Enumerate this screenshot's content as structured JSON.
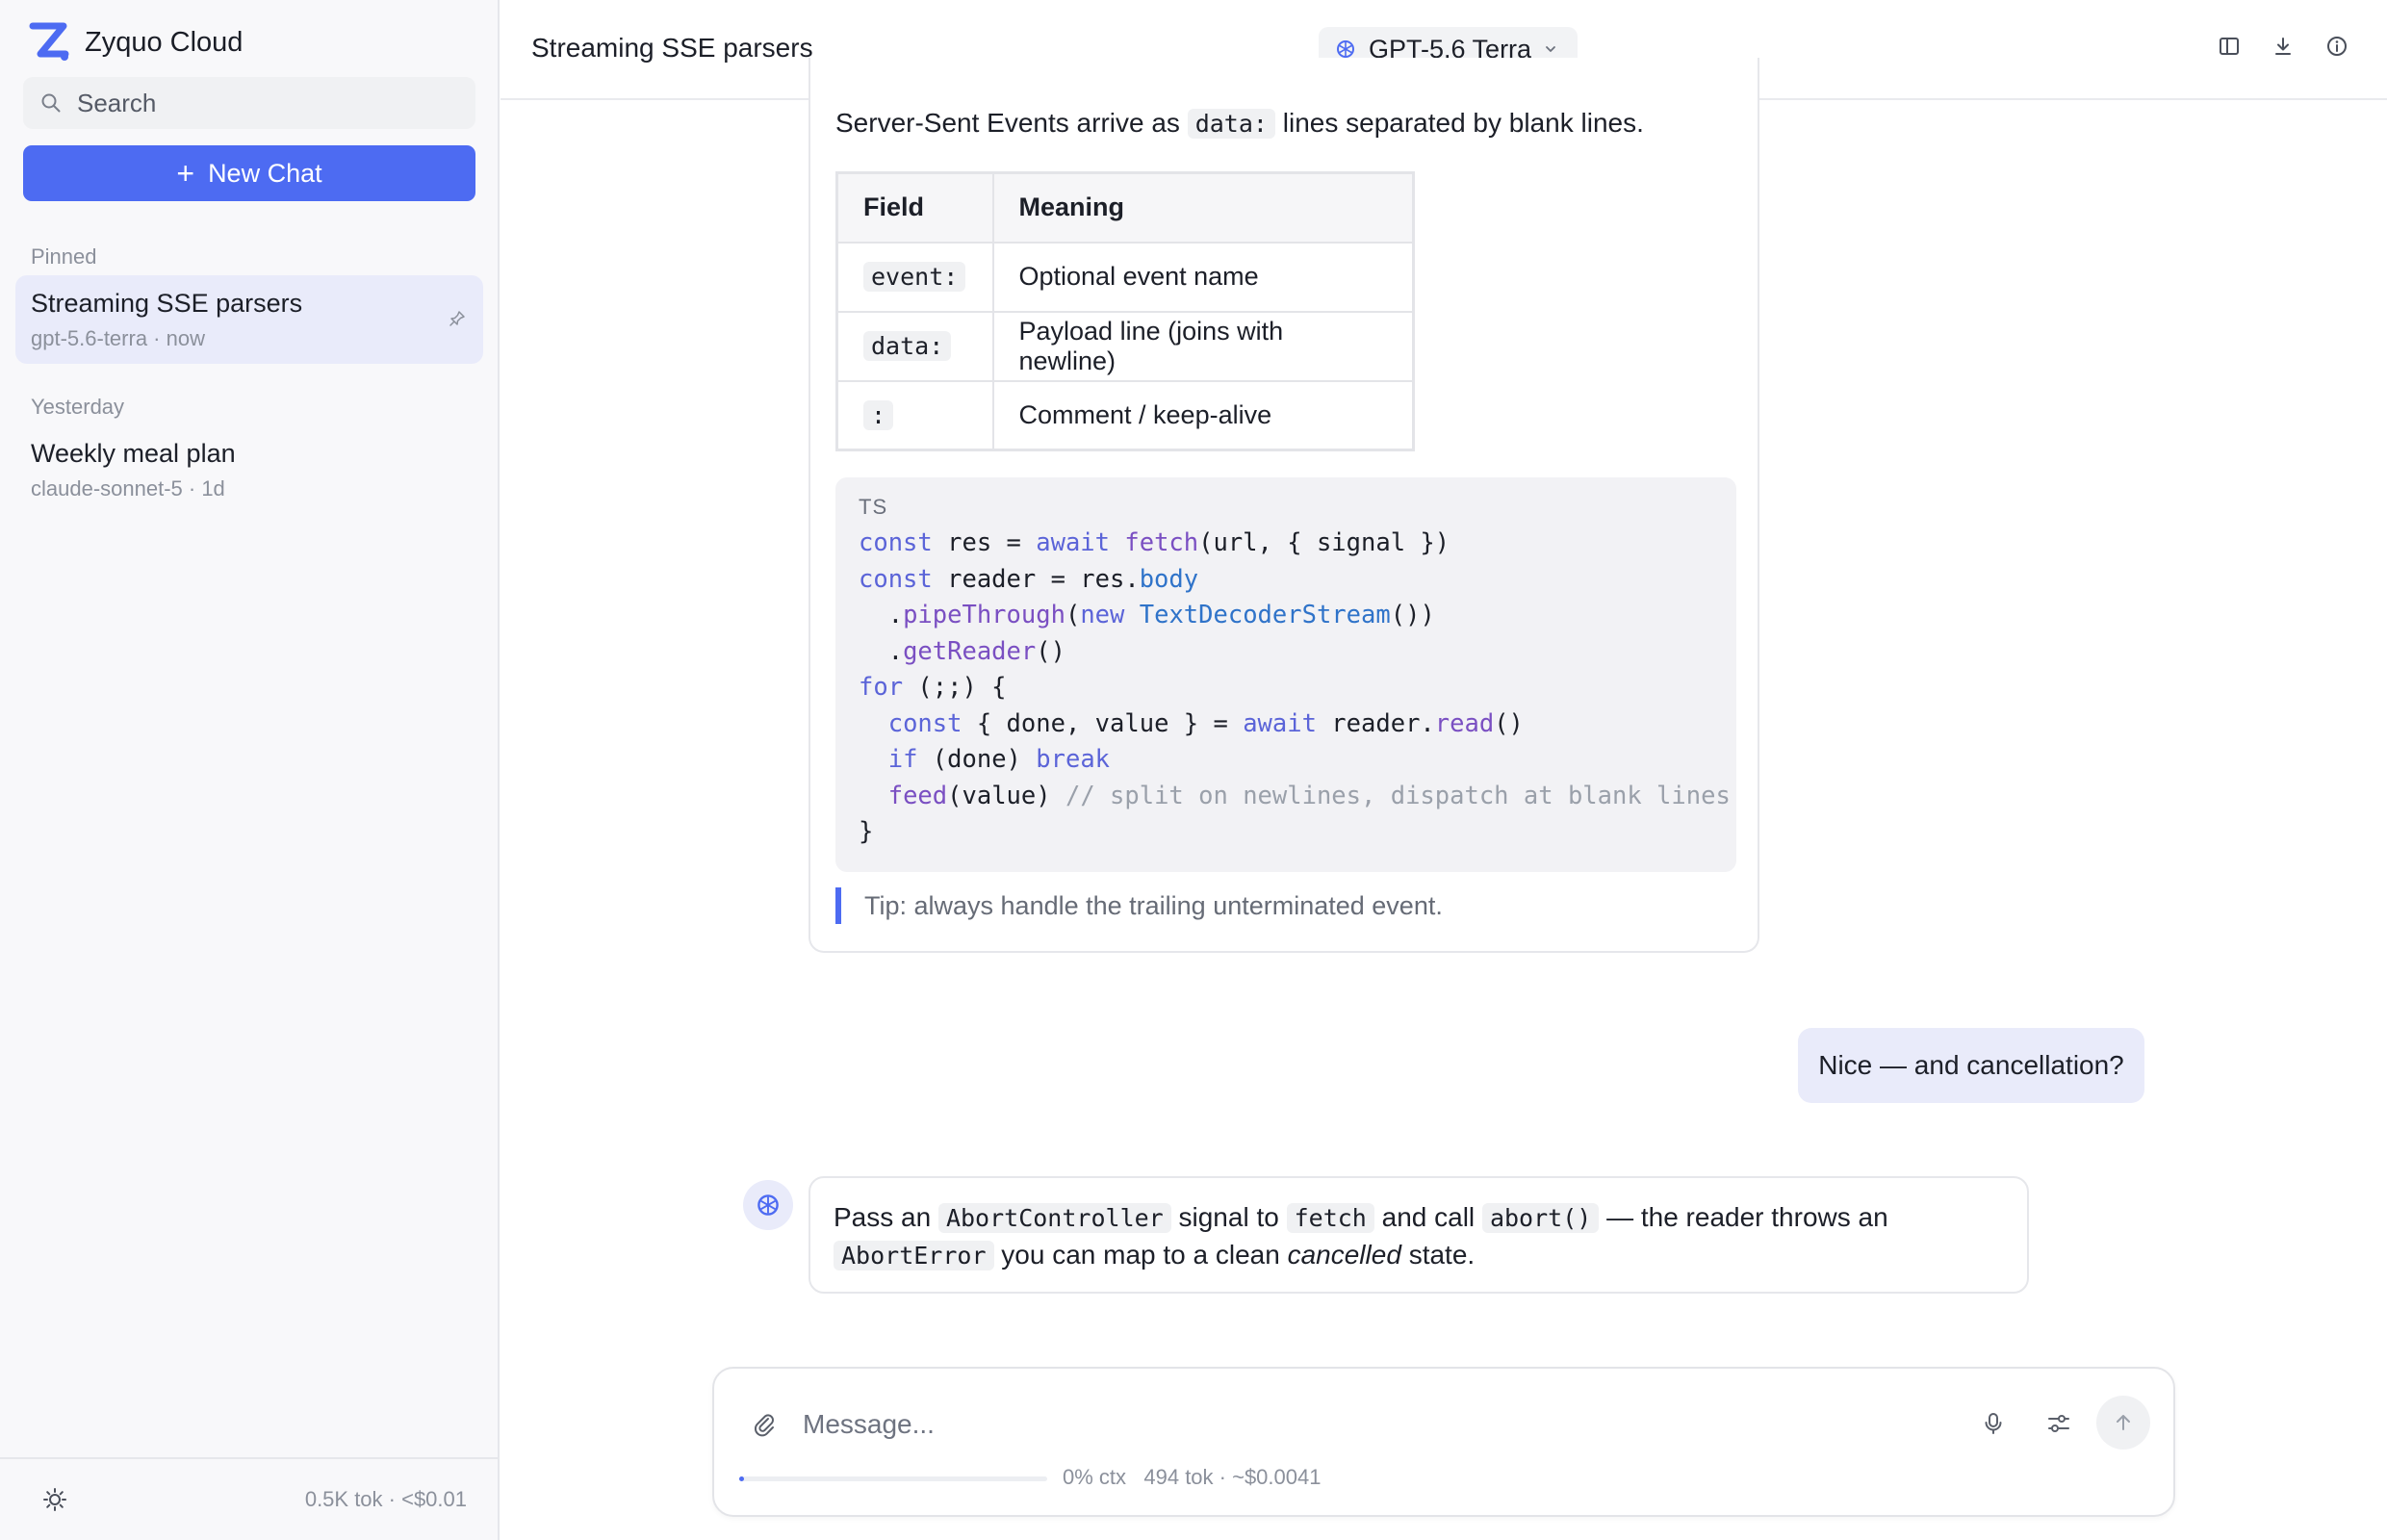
{
  "app": {
    "name": "Zyquo Cloud"
  },
  "sidebar": {
    "search_label": "Search",
    "new_chat_label": "New Chat",
    "sections": [
      {
        "label": "Pinned",
        "items": [
          {
            "title": "Streaming SSE parsers",
            "meta": "gpt-5.6-terra · now",
            "active": true,
            "pinned": true
          }
        ]
      },
      {
        "label": "Yesterday",
        "items": [
          {
            "title": "Weekly meal plan",
            "meta": "claude-sonnet-5 · 1d",
            "active": false,
            "pinned": false
          }
        ]
      }
    ],
    "footer_usage": "0.5K tok · <$0.01"
  },
  "header": {
    "title": "Streaming SSE parsers",
    "model": "GPT-5.6 Terra",
    "icons": [
      "split-view-icon",
      "download-icon",
      "info-icon"
    ]
  },
  "messages": {
    "assistant1": {
      "intro_before": "Server-Sent Events arrive as",
      "intro_code": "data:",
      "intro_after": "lines separated by blank lines.",
      "table": {
        "headers": [
          "Field",
          "Meaning"
        ],
        "rows": [
          [
            "event:",
            "Optional event name"
          ],
          [
            "data:",
            "Payload line (joins with newline)"
          ],
          [
            ":",
            "Comment / keep-alive"
          ]
        ]
      },
      "code": {
        "lang": "TS",
        "lines": [
          "const res = await fetch(url, { signal })",
          "const reader = res.body",
          "  .pipeThrough(new TextDecoderStream())",
          "  .getReader()",
          "for (;;) {",
          "  const { done, value } = await reader.read()",
          "  if (done) break",
          "  feed(value) // split on newlines, dispatch at blank lines",
          "}"
        ]
      },
      "tip": "Tip: always handle the trailing unterminated event."
    },
    "user": "Nice — and cancellation?",
    "assistant2": {
      "p1": "Pass an",
      "c1": "AbortController",
      "p2": "signal to",
      "c2": "fetch",
      "p3": "and call",
      "c3": "abort()",
      "p4": "— the reader throws an",
      "c4": "AbortError",
      "p5": "you can map to a clean",
      "em": "cancelled",
      "p6": "state."
    }
  },
  "composer": {
    "placeholder": "Message...",
    "context_fraction": 0.01,
    "ctx_label": "0% ctx",
    "tokens_label": "494 tok · ~$0.0041"
  },
  "colors": {
    "accent": "#4d6bf2",
    "user_bubble": "#e9ebfa"
  }
}
